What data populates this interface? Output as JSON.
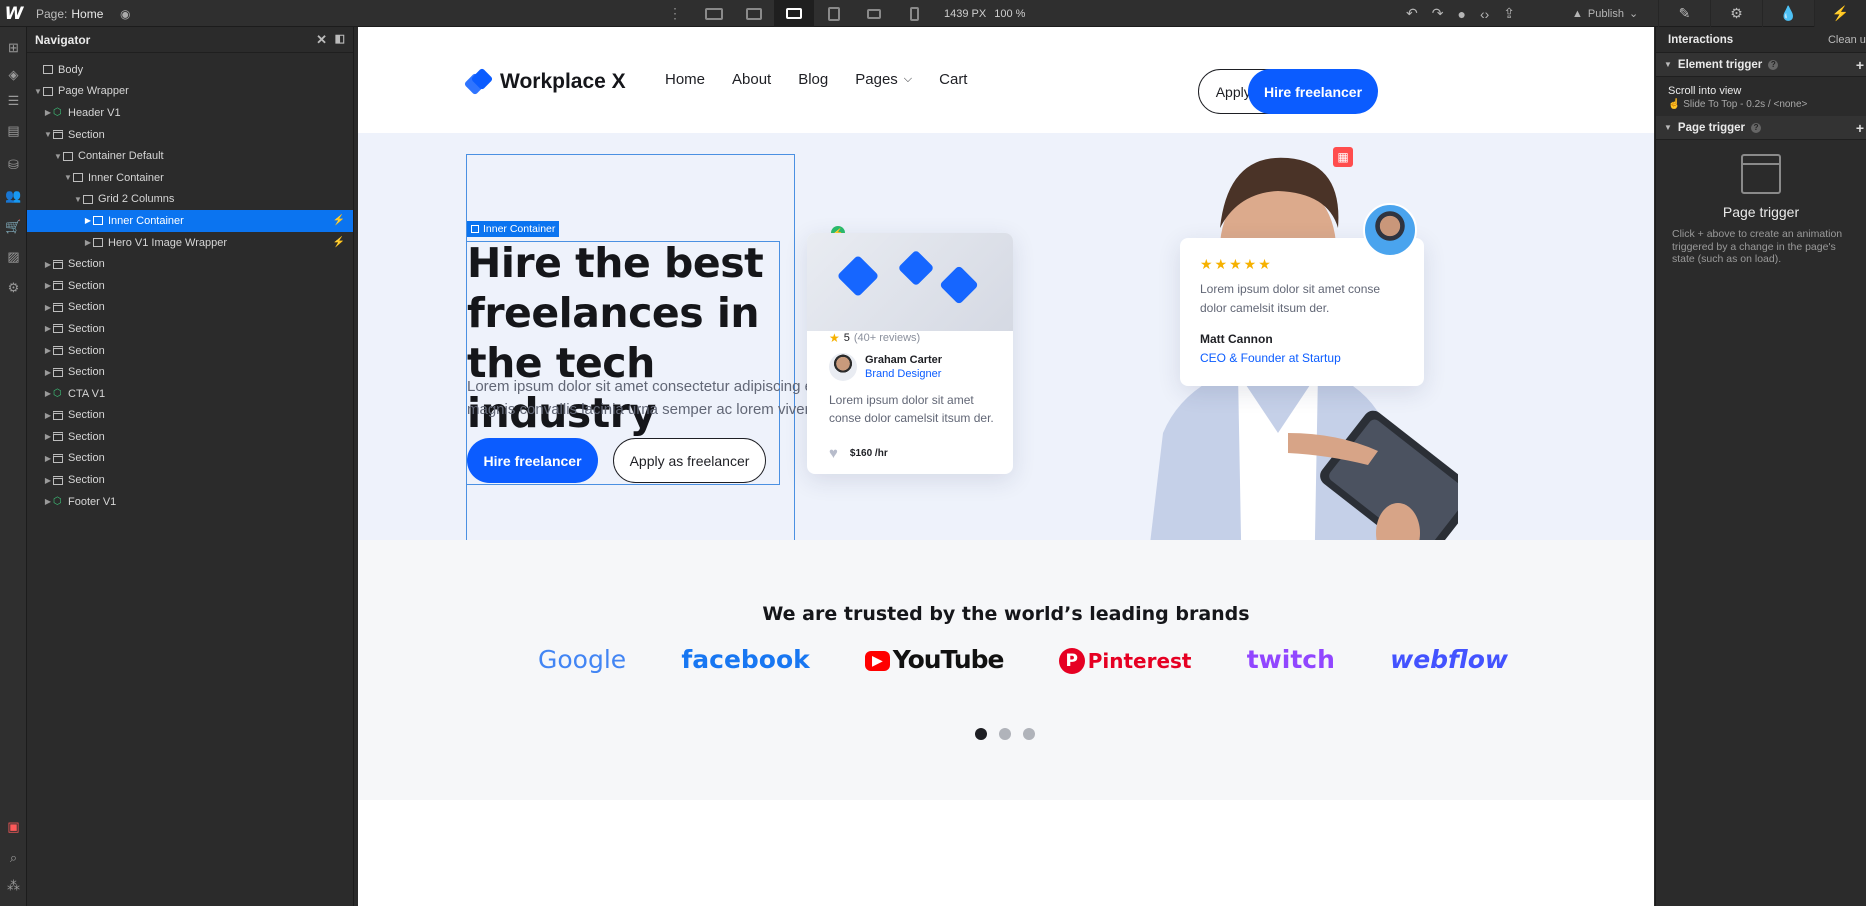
{
  "topbar": {
    "page_label": "Page:",
    "page_value": "Home",
    "width": "1439 PX",
    "zoom": "100 %",
    "publish": "Publish"
  },
  "navigator": {
    "title": "Navigator",
    "items": [
      {
        "label": "Body"
      },
      {
        "label": "Page Wrapper"
      },
      {
        "label": "Header V1"
      },
      {
        "label": "Section"
      },
      {
        "label": "Container Default"
      },
      {
        "label": "Inner Container"
      },
      {
        "label": "Grid 2 Columns"
      },
      {
        "label": "Inner Container"
      },
      {
        "label": "Hero V1 Image Wrapper"
      },
      {
        "label": "Section"
      },
      {
        "label": "Section"
      },
      {
        "label": "Section"
      },
      {
        "label": "Section"
      },
      {
        "label": "Section"
      },
      {
        "label": "Section"
      },
      {
        "label": "CTA V1"
      },
      {
        "label": "Section"
      },
      {
        "label": "Section"
      },
      {
        "label": "Section"
      },
      {
        "label": "Section"
      },
      {
        "label": "Footer V1"
      }
    ]
  },
  "site": {
    "logo": "Workplace X",
    "menu": [
      "Home",
      "About",
      "Blog",
      "Pages",
      "Cart"
    ],
    "apply_now": "Apply now",
    "hire_freelancer": "Hire freelancer",
    "hero_title": "Hire the best freelances in the tech industry",
    "hero_sub": "Lorem ipsum dolor sit amet consectetur adipiscing elit magnis convallis lacinia urna semper ac lorem viverra.",
    "hero_btn1": "Hire freelancer",
    "hero_btn2": "Apply as freelancer",
    "selected_label": "Inner Container",
    "card1": {
      "rating": "5",
      "reviews": "(40+ reviews)",
      "name": "Graham Carter",
      "role": "Brand Designer",
      "text": "Lorem ipsum dolor sit amet conse dolor camelsit itsum der.",
      "price": "$160 /hr"
    },
    "card2": {
      "stars": "★★★★★",
      "text": "Lorem ipsum dolor sit amet conse dolor camelsit itsum der.",
      "name": "Matt Cannon",
      "role": "CEO & Founder at Startup"
    },
    "trusted_title": "We are trusted by the world’s leading brands",
    "brands": [
      {
        "name": "Google",
        "color": "#4285f4"
      },
      {
        "name": "facebook",
        "color": "#1877f2"
      },
      {
        "name": "YouTube",
        "color": "#111111"
      },
      {
        "name": "Pinterest",
        "color": "#e60023"
      },
      {
        "name": "twitch",
        "color": "#9146ff"
      },
      {
        "name": "webflow",
        "color": "#4353ff"
      }
    ]
  },
  "interactions": {
    "title": "Interactions",
    "clean_up": "Clean up",
    "element_trigger": "Element trigger",
    "scroll_into_view": "Scroll into view",
    "scroll_detail": "Slide To Top - 0.2s / <none>",
    "page_trigger": "Page trigger",
    "pt_title": "Page trigger",
    "pt_desc": "Click + above to create an animation triggered by a change in the page's state (such as on load)."
  }
}
